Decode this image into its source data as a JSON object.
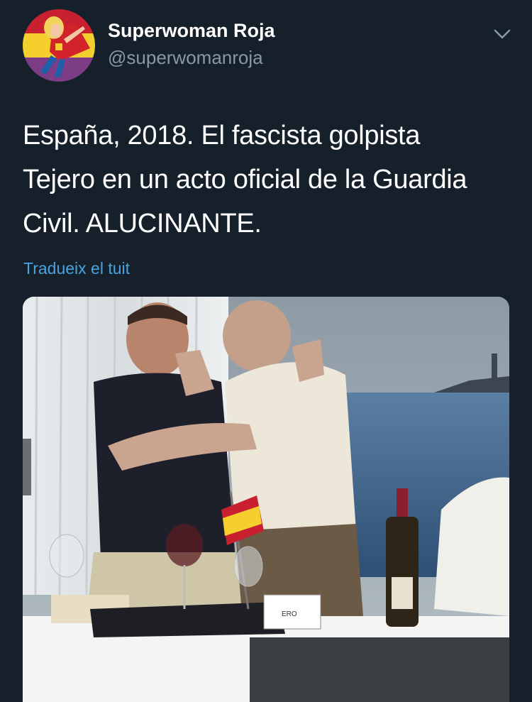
{
  "author": {
    "display_name": "Superwoman Roja",
    "handle": "@superwomanroja",
    "avatar_icon": "superwoman-avatar-icon"
  },
  "menu": {
    "icon": "chevron-down-icon"
  },
  "tweet": {
    "text_lines": [
      "España, 2018. El fascista golpista",
      "Tejero en un acto oficial de la Guardia",
      "Civil. ALUCINANTE."
    ],
    "translate_label": "Tradueix el tuit"
  },
  "media": {
    "type": "video-still",
    "description_icon": "photo-icon",
    "place_card_text": "ERO"
  },
  "colors": {
    "background": "#15202b",
    "text": "#ffffff",
    "secondary_text": "#8899a6",
    "link": "#4aa3df"
  }
}
